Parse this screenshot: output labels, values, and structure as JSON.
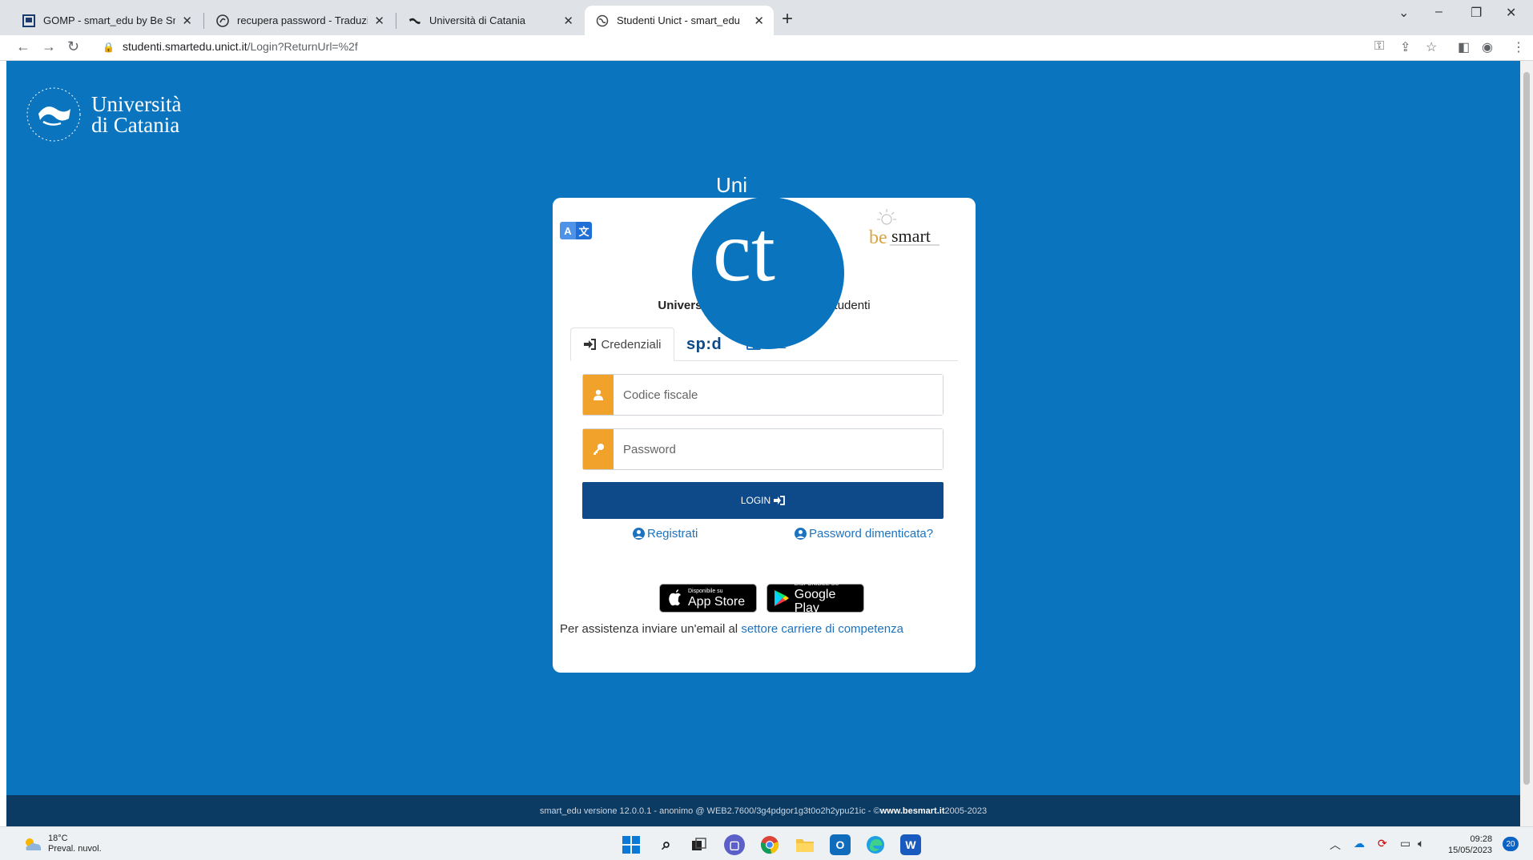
{
  "browser": {
    "tabs": [
      {
        "title": "GOMP - smart_edu by Be Smart",
        "icon": "gomp-favicon"
      },
      {
        "title": "recupera password - Traduzione",
        "icon": "reverso-favicon"
      },
      {
        "title": "Università di Catania",
        "icon": "unict-favicon"
      },
      {
        "title": "Studenti Unict - smart_edu",
        "icon": "globe-favicon"
      }
    ],
    "new_tab": "+",
    "url_host": "studenti.smartedu.unict.it",
    "url_path": "/Login?ReturnUrl=%2f"
  },
  "site": {
    "logo_line1": "Università",
    "logo_line2": "di Catania",
    "badge_top": "Uni",
    "badge_main": "ct",
    "besmart_brand": "be smart",
    "portal_university": "Università di Catania",
    "portal_sep": " / ",
    "portal_name": "Portale studenti"
  },
  "login": {
    "tabs": {
      "credentials": "Credenziali",
      "spid": "sp:d",
      "cie": "CIE"
    },
    "fiscal_code_placeholder": "Codice fiscale",
    "password_placeholder": "Password",
    "login_button": "LOGIN",
    "register_link": "Registrati",
    "forgot_link": "Password dimenticata?",
    "appstore_small": "Disponibile su",
    "appstore_big": "App Store",
    "googleplay_small": "DISPONIBILE SU",
    "googleplay_big": "Google Play",
    "assist_text": "Per assistenza inviare un'email al ",
    "assist_link": "settore carriere di competenza"
  },
  "footer": {
    "text": "smart_edu versione 12.0.0.1 - anonimo @ WEB2.7600/3g4pdgor1g3t0o2h2ypu21ic - © ",
    "brand": "www.besmart.it",
    "years": " 2005-2023"
  },
  "taskbar": {
    "temperature": "18°C",
    "weather": "Preval. nuvol.",
    "time": "09:28",
    "date": "15/05/2023",
    "notifications": "20"
  },
  "colors": {
    "page_bg": "#0a74bf",
    "accent_orange": "#f1a22b",
    "login_button": "#0e4a8a",
    "link_blue": "#1e73be",
    "footer_bg": "#0b3a62"
  }
}
